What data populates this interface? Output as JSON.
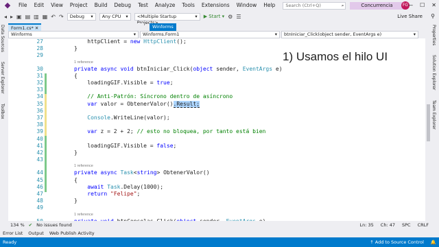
{
  "titlebar": {
    "menu": [
      "File",
      "Edit",
      "View",
      "Project",
      "Build",
      "Debug",
      "Test",
      "Analyze",
      "Tools",
      "Extensions",
      "Window",
      "Help"
    ],
    "search_placeholder": "Search (Ctrl+Q)",
    "solution_name": "Concurrencia",
    "avatar_initials": "FG",
    "minimize": "—",
    "maximize": "☐",
    "close": "✕"
  },
  "toolbar": {
    "config": "Debug",
    "platform": "Any CPU",
    "startup": "<Multiple Startup Projects>",
    "start": "▶ Start ▾",
    "live_share": "Live Share"
  },
  "left_rail": [
    "Data Sources",
    "Server Explorer",
    "Toolbox"
  ],
  "right_rail": [
    "Properties",
    "Solution Explorer",
    "Team Explorer"
  ],
  "tabs": {
    "file_tab": "Form1.cs*",
    "file_tab_close": "✕",
    "pinned_tab": "Winforms"
  },
  "navbar": {
    "project": "Winforms",
    "class": "Winforms.Form1",
    "member": "btnIniciar_Click(object sender, EventArgs e)"
  },
  "annotation": "1) Usamos el hilo UI",
  "reference_label": "1 reference",
  "code_lines": [
    {
      "n": "27",
      "t": "            httpClient = new HttpClient();"
    },
    {
      "n": "28",
      "t": "        }"
    },
    {
      "n": "29",
      "t": ""
    },
    {
      "n": "30",
      "t": "        private async void btnIniciar_Click(object sender, EventArgs e)",
      "ref": true
    },
    {
      "n": "31",
      "t": "        {"
    },
    {
      "n": "32",
      "t": "            loadingGIF.Visible = true;"
    },
    {
      "n": "33",
      "t": ""
    },
    {
      "n": "34",
      "t": "            // Anti-Patrón: Síncrono dentro de asíncrono"
    },
    {
      "n": "35",
      "t": "            var valor = ObtenerValor().Result;"
    },
    {
      "n": "36",
      "t": ""
    },
    {
      "n": "37",
      "t": "            Console.WriteLine(valor);"
    },
    {
      "n": "38",
      "t": ""
    },
    {
      "n": "39",
      "t": "            var z = 2 + 2; // esto no bloquea, por tanto está bien"
    },
    {
      "n": "40",
      "t": ""
    },
    {
      "n": "41",
      "t": "            loadingGIF.Visible = false;"
    },
    {
      "n": "42",
      "t": "        }"
    },
    {
      "n": "43",
      "t": ""
    },
    {
      "n": "44",
      "t": "        private async Task<string> ObtenerValor()",
      "ref": true
    },
    {
      "n": "45",
      "t": "        {"
    },
    {
      "n": "46",
      "t": "            await Task.Delay(1000);"
    },
    {
      "n": "47",
      "t": "            return \"Felipe\";"
    },
    {
      "n": "48",
      "t": "        }"
    },
    {
      "n": "49",
      "t": ""
    },
    {
      "n": "50",
      "t": "        private void btnConsolas_Click(object sender, EventArgs e)",
      "ref": true
    }
  ],
  "status_line": {
    "zoom": "134 %",
    "issues": "No issues found",
    "position": "Ln: 35",
    "column": "Ch: 47",
    "spc": "SPC",
    "crlf": "CRLF"
  },
  "bottom_tabs": [
    "Error List",
    "Output",
    "Web Publish Activity"
  ],
  "statusbar": {
    "ready": "Ready",
    "add_source": "↑ Add to Source Control",
    "bell": "🔔"
  }
}
